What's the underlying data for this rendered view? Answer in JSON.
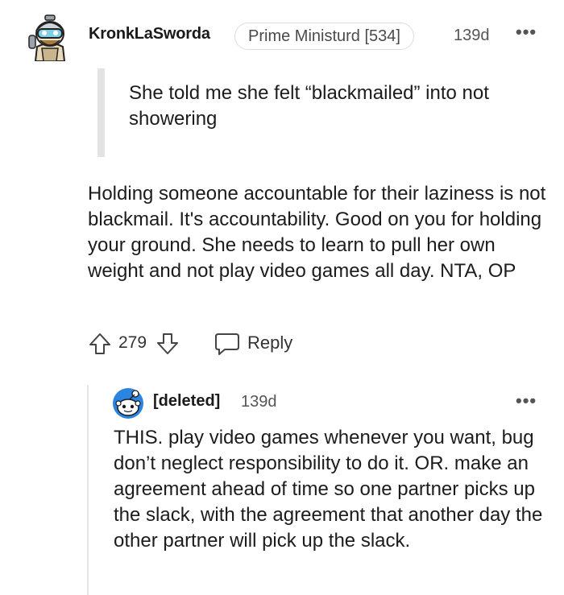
{
  "comment": {
    "username": "KronkLaSworda",
    "flair": "Prime Ministurd [534]",
    "time": "139d",
    "more": "•••",
    "quote": "She told me she felt “blackmailed” into not showering",
    "body": "Holding someone accountable for their laziness is not blackmail. It's accountability. Good on you for holding your ground. She needs to learn to pull her own weight and not play video games all day. NTA, OP",
    "score": "279",
    "reply_label": "Reply",
    "avatar_icon": "snoo-avatar-diver",
    "upvote_icon": "arrow-up-icon",
    "downvote_icon": "arrow-down-icon",
    "reply_icon": "speech-bubble-icon"
  },
  "reply": {
    "username": "[deleted]",
    "time": "139d",
    "more": "•••",
    "body": "THIS. play video games whenever you want, bug don’t neglect responsibility to do it. OR. make an agreement ahead of time so one partner picks up the slack, with the agreement that another day the other partner will pick up the slack.",
    "avatar_icon": "snoo-avatar-default"
  },
  "colors": {
    "text": "#1a1a1b",
    "muted": "#555555",
    "quote_bar": "#e3e3e3",
    "flair_border": "#dcdcdc",
    "avatar_blue": "#2b84e0"
  }
}
